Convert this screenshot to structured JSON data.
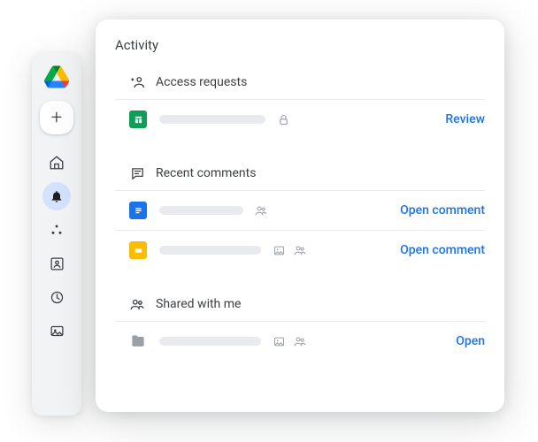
{
  "panel": {
    "title": "Activity"
  },
  "sections": {
    "access": {
      "label": "Access requests",
      "rows": [
        {
          "action": "Review"
        }
      ]
    },
    "comments": {
      "label": "Recent comments",
      "rows": [
        {
          "action": "Open comment"
        },
        {
          "action": "Open comment"
        }
      ]
    },
    "shared": {
      "label": "Shared with me",
      "rows": [
        {
          "action": "Open"
        }
      ]
    }
  }
}
